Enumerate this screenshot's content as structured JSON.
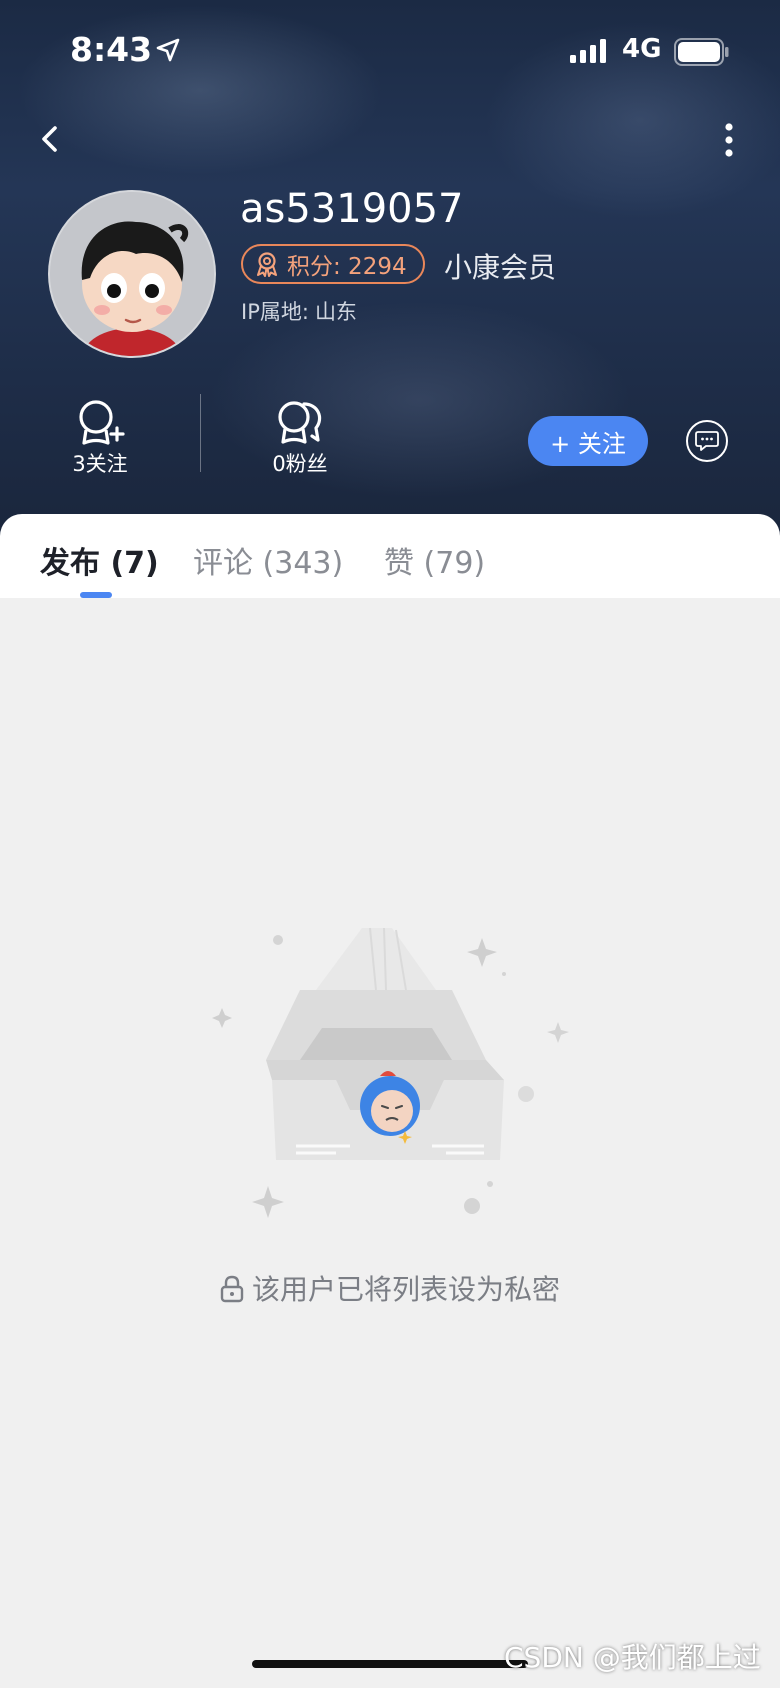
{
  "status_bar": {
    "time": "8:43",
    "network": "4G"
  },
  "profile": {
    "username": "as5319057",
    "points_label": "积分: 2294",
    "member_label": "小康会员",
    "ip_label": "IP属地:",
    "ip_value": "山东"
  },
  "stats": {
    "following": "3关注",
    "fans": "0粉丝"
  },
  "actions": {
    "follow_label": "+ 关注"
  },
  "tabs": [
    {
      "label": "发布 (7)",
      "active": true
    },
    {
      "label": "评论 (343)",
      "active": false
    },
    {
      "label": "赞 (79)",
      "active": false
    }
  ],
  "empty_state": {
    "message": "该用户已将列表设为私密"
  },
  "watermark": "CSDN @我们都上过",
  "colors": {
    "accent": "#4b86f2",
    "badge": "#e9875a",
    "header_bg": "#1e2d48",
    "content_bg": "#f0f0f0"
  }
}
